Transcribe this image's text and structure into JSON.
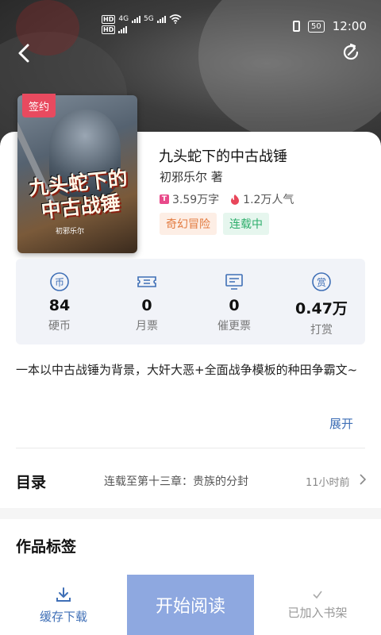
{
  "status_bar": {
    "hd1": "HD",
    "net1": "4G",
    "hd2": "HD",
    "net2": "5G",
    "battery": "50",
    "time": "12:00"
  },
  "book": {
    "sign_badge": "签约",
    "cover_title": "九头蛇下的中古战锤",
    "cover_author": "初邪乐尔",
    "title": "九头蛇下的中古战锤",
    "author": "初邪乐尔",
    "author_suffix": "著",
    "word_count": "3.59万字",
    "popularity": "1.2万人气",
    "tags": [
      "奇幻冒险",
      "连载中"
    ]
  },
  "stats": [
    {
      "value": "84",
      "label": "硬币",
      "icon": "coin-icon"
    },
    {
      "value": "0",
      "label": "月票",
      "icon": "ticket-icon"
    },
    {
      "value": "0",
      "label": "催更票",
      "icon": "update-request-icon"
    },
    {
      "value": "0.47万",
      "label": "打赏",
      "icon": "reward-icon"
    }
  ],
  "description": "一本以中古战锤为背景，大奸大恶+全面战争模板的种田争霸文~",
  "expand_label": "展开",
  "toc": {
    "title": "目录",
    "latest": "连载至第十三章：贵族的分封",
    "time": "11小时前"
  },
  "section_tags_title": "作品标签",
  "bottom": {
    "download": "缓存下载",
    "read": "开始阅读",
    "shelf": "已加入书架"
  },
  "colors": {
    "accent": "#3f6fb6",
    "read_button": "#8ea8e0",
    "sign_badge": "#e84a5f",
    "genre_tag": "#e27a3e",
    "status_tag": "#2eae6c"
  }
}
